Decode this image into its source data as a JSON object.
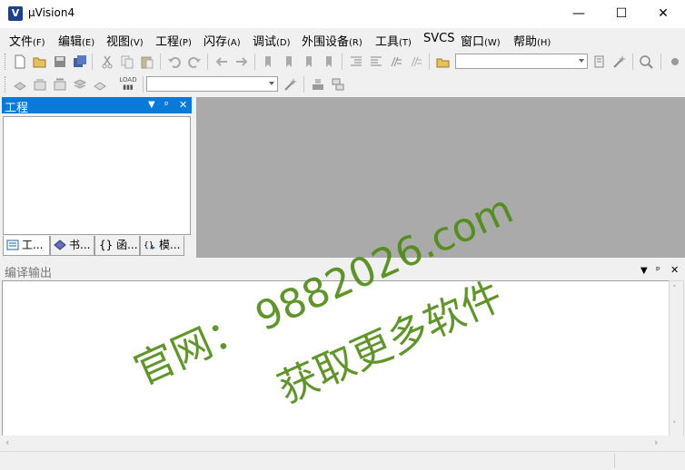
{
  "window": {
    "title": "µVision4",
    "icon_letter": "V",
    "minimize": "—",
    "maximize": "☐",
    "close": "✕"
  },
  "menu": [
    {
      "label": "文件",
      "accel": "(F)"
    },
    {
      "label": "编辑",
      "accel": "(E)"
    },
    {
      "label": "视图",
      "accel": "(V)"
    },
    {
      "label": "工程",
      "accel": "(P)"
    },
    {
      "label": "闪存",
      "accel": "(A)"
    },
    {
      "label": "调试",
      "accel": "(D)"
    },
    {
      "label": "外围设备",
      "accel": "(R)"
    },
    {
      "label": "工具",
      "accel": "(T)"
    },
    {
      "label": "SVCS",
      "accel": ""
    },
    {
      "label": "窗口",
      "accel": "(W)"
    },
    {
      "label": "帮助",
      "accel": "(H)"
    }
  ],
  "toolbar2": {
    "load_label": "LOAD"
  },
  "project_pane": {
    "title": "工程",
    "tabs": [
      {
        "label": "工..."
      },
      {
        "label": "书..."
      },
      {
        "label": "{} 函..."
      },
      {
        "label": "模..."
      }
    ]
  },
  "build_output": {
    "title": "编译输出"
  },
  "pane_controls": {
    "dropdown": "▼",
    "pin": "ᵖ",
    "close": "✕"
  },
  "watermark": {
    "line1": "官网：  9882026.com",
    "line2": "获取更多软件",
    "color": "#4e8a12"
  }
}
